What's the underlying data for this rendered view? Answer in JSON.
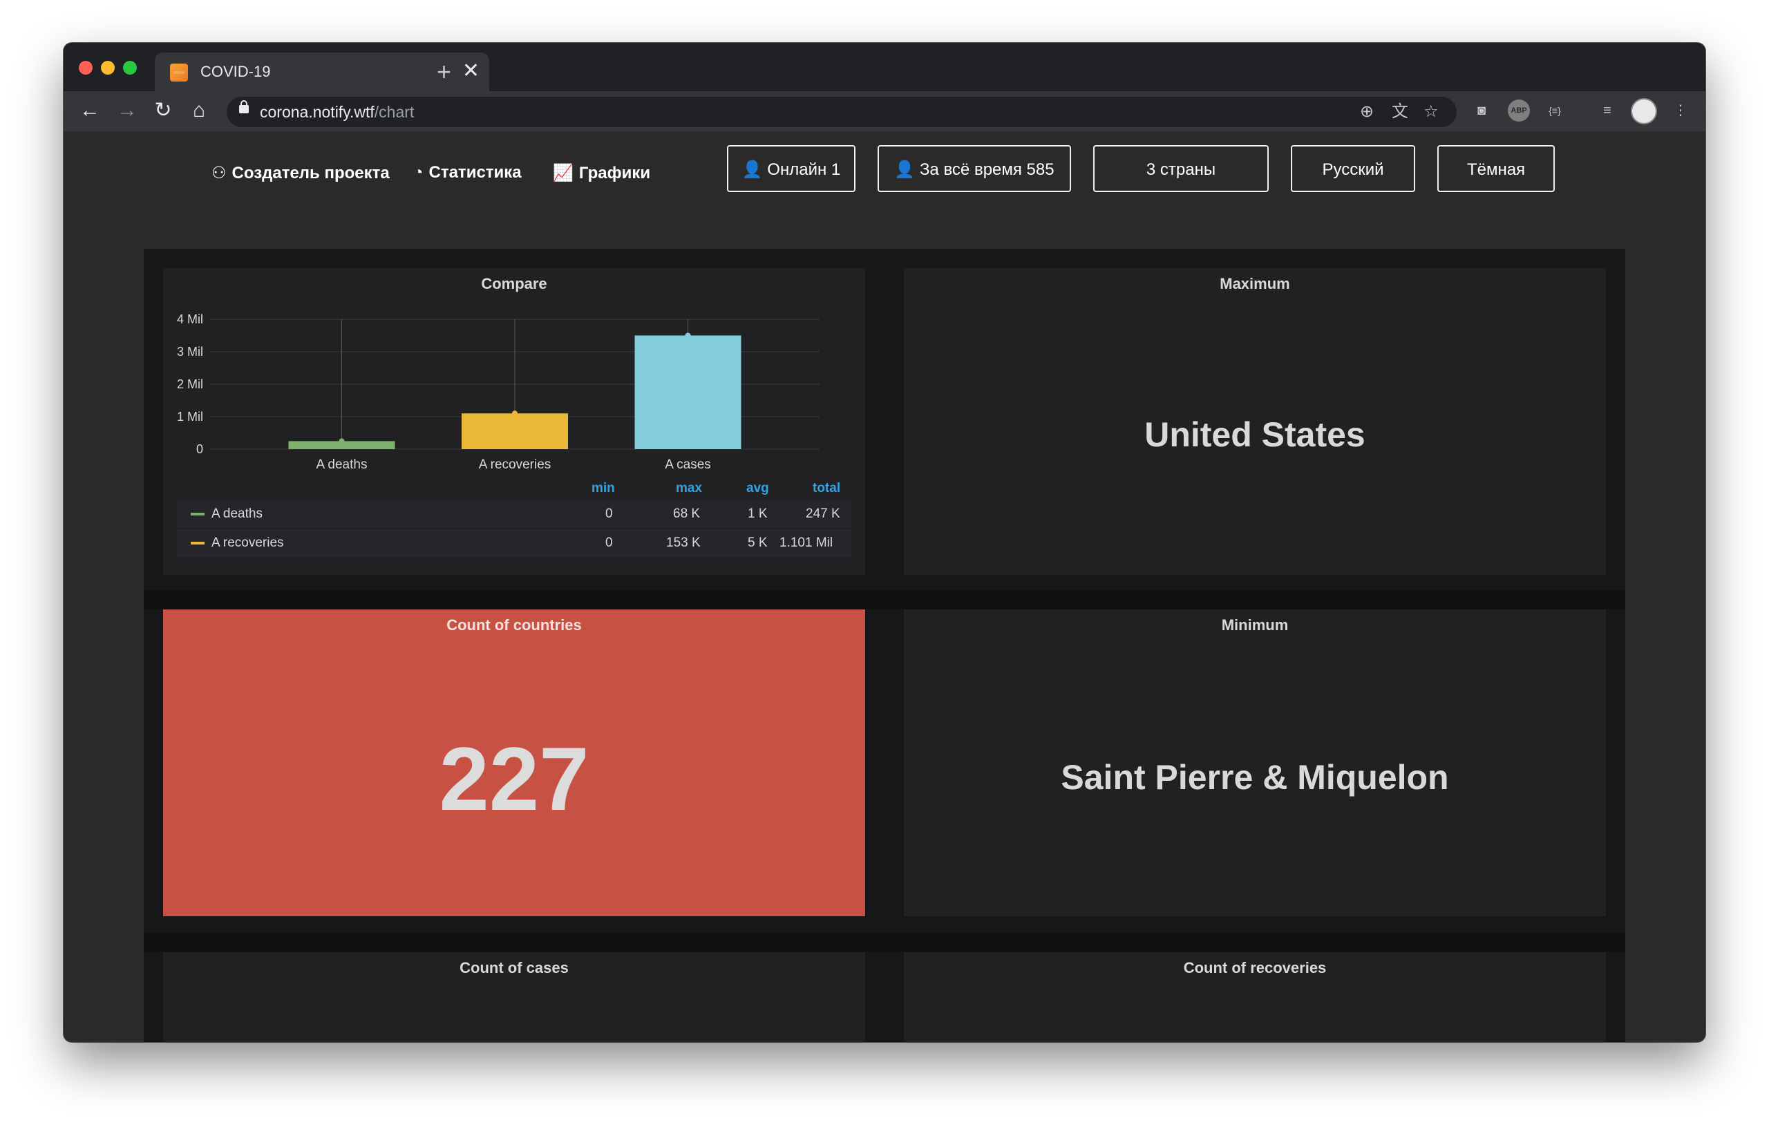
{
  "browser": {
    "tab_title": "COVID-19",
    "tab_close": "✕",
    "new_tab": "+",
    "url_host": "corona.notify.wtf",
    "url_path": "/chart"
  },
  "topnav": {
    "links": [
      {
        "icon": "users-icon",
        "label": "Создатель проекта"
      },
      {
        "icon": "pie-chart-icon",
        "label": "Статистика"
      },
      {
        "icon": "line-chart-icon",
        "label": "Графики"
      }
    ],
    "online": "Онлайн 1",
    "all_time": "За всё время 585",
    "countries": "3 страны",
    "language": "Русский",
    "theme": "Тёмная"
  },
  "panels": {
    "compare": {
      "title": "Compare"
    },
    "maximum": {
      "title": "Maximum",
      "value": "United States"
    },
    "count_countries": {
      "title": "Count of countries",
      "value": "227",
      "color": "#c75243"
    },
    "minimum": {
      "title": "Minimum",
      "value": "Saint Pierre & Miquelon"
    },
    "count_cases": {
      "title": "Count of cases"
    },
    "count_recoveries": {
      "title": "Count of recoveries"
    }
  },
  "legend": {
    "headers": [
      "min",
      "max",
      "avg",
      "total"
    ],
    "rows": [
      {
        "name": "A deaths",
        "color": "#7eb26d",
        "min": "0",
        "max": "68 K",
        "avg": "1 K",
        "total": "247 K"
      },
      {
        "name": "A recoveries",
        "color": "#eab839",
        "min": "0",
        "max": "153 K",
        "avg": "5 K",
        "total": "1.101 Mil"
      }
    ]
  },
  "chart_data": {
    "type": "bar",
    "title": "Compare",
    "categories": [
      "A deaths",
      "A recoveries",
      "A cases"
    ],
    "values": [
      247000,
      1101000,
      3500000
    ],
    "colors": [
      "#7eb26d",
      "#eab839",
      "#82ccdd"
    ],
    "y_ticks": [
      "0",
      "1 Mil",
      "2 Mil",
      "3 Mil",
      "4 Mil"
    ],
    "ylim": [
      0,
      4000000
    ],
    "grid": true
  }
}
